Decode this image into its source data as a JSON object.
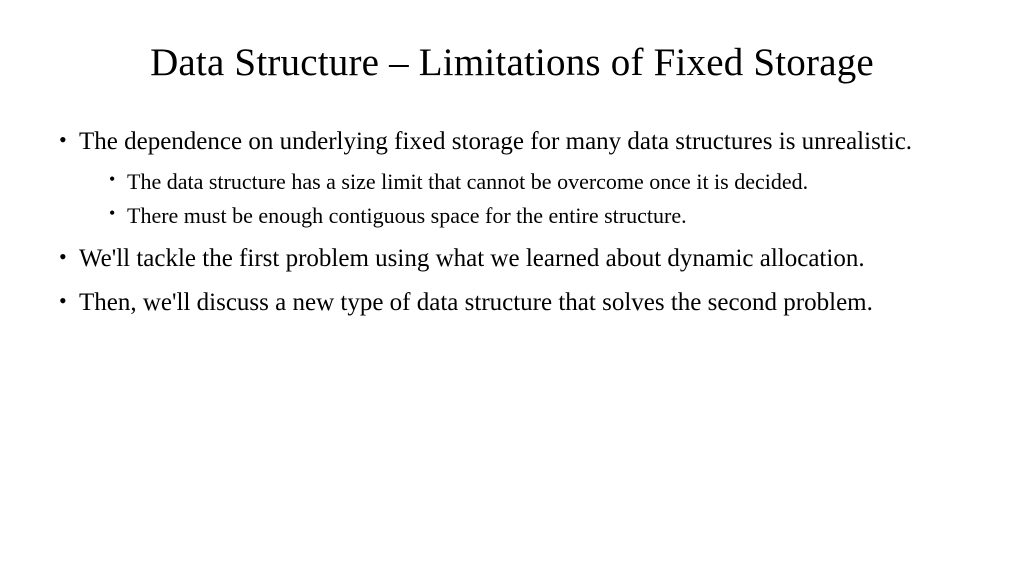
{
  "title": "Data Structure – Limitations of Fixed Storage",
  "bullets": {
    "item1": "The dependence on underlying fixed storage for many data structures is unrealistic.",
    "item1_sub1": "The data structure has a size limit that cannot be overcome once it is decided.",
    "item1_sub2": "There must be enough contiguous space for the entire structure.",
    "item2": "We'll tackle the first problem using what we learned about dynamic allocation.",
    "item3": "Then, we'll discuss a new type of data structure that solves the second problem."
  }
}
